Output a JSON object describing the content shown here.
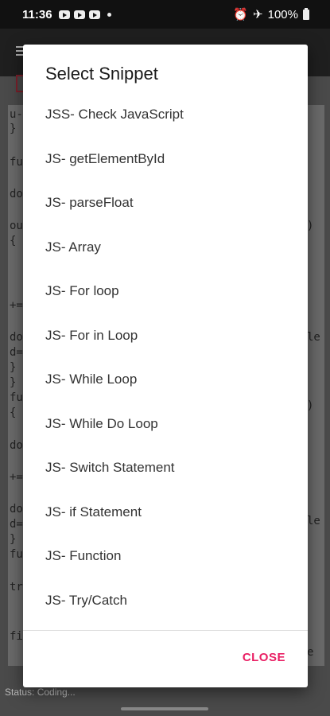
{
  "status_bar": {
    "time": "11:36",
    "battery": "100%",
    "icons_left": [
      "youtube-icon",
      "youtube-icon",
      "youtube-icon",
      "dot-icon"
    ],
    "icons_right": [
      "alarm-icon",
      "airplane-icon",
      "battery-icon"
    ]
  },
  "background_app": {
    "status_text": "Status: Coding...",
    "code_fragments": [
      {
        "text": "u-",
        "right": false
      },
      {
        "text": "}",
        "right": false
      },
      {
        "text": "fu",
        "right": false
      },
      {
        "text": "do",
        "right": false
      },
      {
        "text": "ou",
        "right": false
      },
      {
        "text": "{",
        "right": false
      },
      {
        "text": "+=",
        "right": false
      },
      {
        "text": "do",
        "right": false
      },
      {
        "text": "d=",
        "right": false
      },
      {
        "text": "}",
        "right": false
      },
      {
        "text": "}",
        "right": false
      },
      {
        "text": "fu",
        "right": false
      },
      {
        "text": "{",
        "right": false
      },
      {
        "text": "do",
        "right": false
      },
      {
        "text": "+=",
        "right": false
      },
      {
        "text": "do",
        "right": false
      },
      {
        "text": "d=",
        "right": false
      },
      {
        "text": "}",
        "right": false
      },
      {
        "text": "fu",
        "right": false
      },
      {
        "text": "tr",
        "right": false
      },
      {
        "text": "fi",
        "right": false
      }
    ],
    "code_fragments_right": [
      ")",
      "le",
      ")",
      "le",
      "e"
    ]
  },
  "dialog": {
    "title": "Select Snippet",
    "items": [
      "JSS- Check JavaScript",
      "JS- getElementById",
      "JS- parseFloat",
      "JS- Array",
      "JS- For loop",
      "JS- For in Loop",
      "JS- While Loop",
      "JS- While Do Loop",
      "JS- Switch Statement",
      "JS- if Statement",
      "JS- Function",
      "JS- Try/Catch"
    ],
    "close_label": "CLOSE"
  },
  "colors": {
    "accent": "#e91e63",
    "dialog_bg": "#ffffff",
    "scrim": "#4a4a4a"
  }
}
